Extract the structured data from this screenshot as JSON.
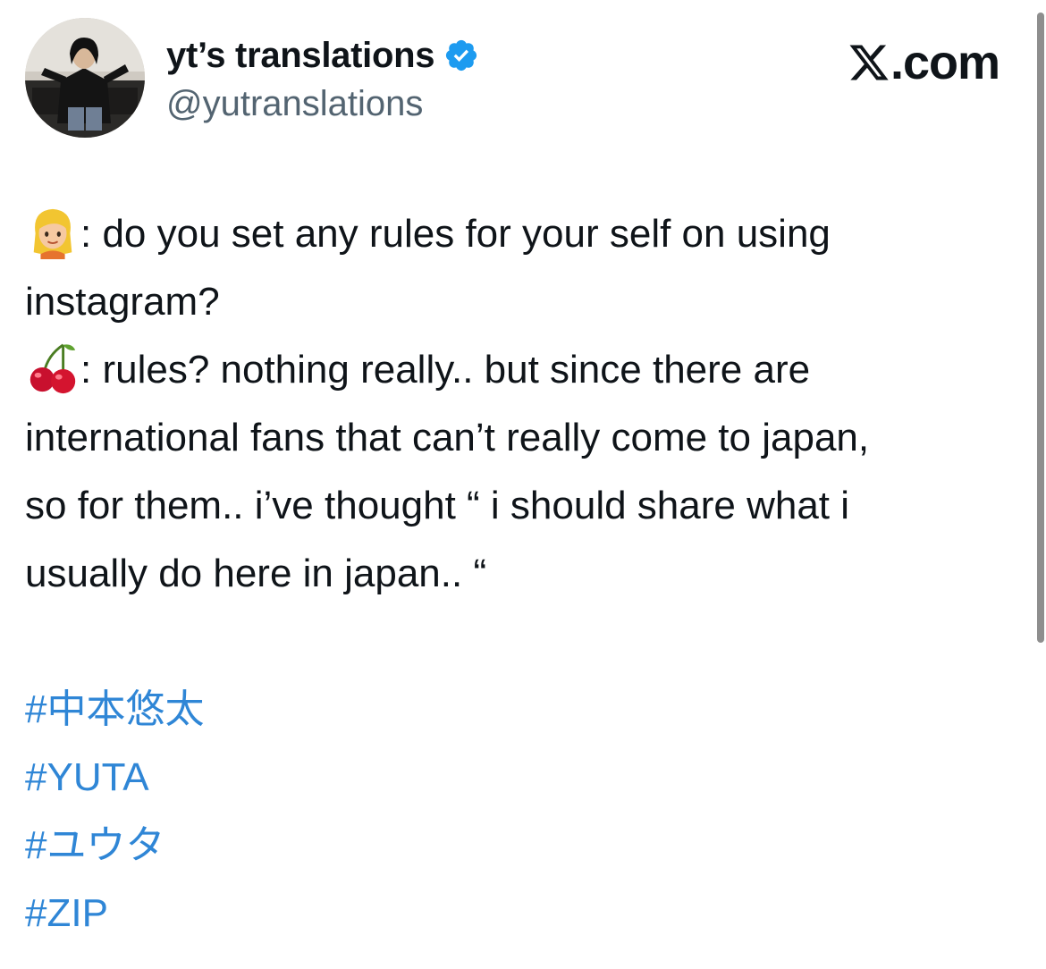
{
  "tweet": {
    "author": {
      "display_name": "yt’s translations",
      "handle": "@yutranslations",
      "verified": true,
      "avatar": "avatar-photo",
      "verified_icon": "verified-badge-icon"
    },
    "brand": {
      "icon": "x-logo-icon",
      "text": ".com"
    },
    "body": {
      "line1_emoji": "woman-blond-hair-emoji",
      "line1": ": do you set any rules for your self on using",
      "line2": "instagram?",
      "line3_emoji": "cherries-emoji",
      "line3": ": rules? nothing really.. but since there are",
      "line4": "international fans that can’t really come to japan,",
      "line5": "so for them.. i’ve thought “ i should share what i",
      "line6": "usually do here in japan.. “"
    },
    "hashtags": [
      "#中本悠太",
      "#YUTA",
      "#ユウタ",
      "#ZIP"
    ]
  },
  "colors": {
    "text": "#0f1419",
    "secondary": "#536471",
    "link": "#2f86d6",
    "verified": "#1d9bf0"
  }
}
